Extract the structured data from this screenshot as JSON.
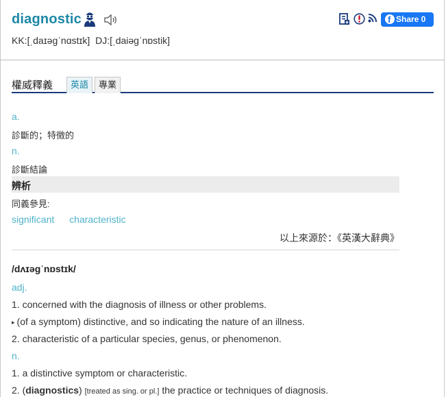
{
  "header": {
    "headword": "diagnostic",
    "kk_label": "KK:[ˌdaɪəgˈnɑstɪk]",
    "dj_label": "DJ:[ˌdaiəgˈnɒstik]",
    "share_label": "Share 0"
  },
  "tabs_section": {
    "title": "權威釋義",
    "tabs": [
      {
        "label": "英語",
        "active": true
      },
      {
        "label": "專業",
        "active": false
      }
    ]
  },
  "authoritative": {
    "entries": [
      {
        "pos": "a.",
        "meaning": "診斷的；特徵的"
      },
      {
        "pos": "n.",
        "meaning": "診斷結論"
      }
    ],
    "analysis_label": "辨析",
    "synonyms_label": "同義參見:",
    "synonyms": [
      "significant",
      "characteristic"
    ],
    "source": "以上來源於：《英漢大辭典》"
  },
  "english": {
    "phonetic": "/dʌɪəgˈnɒstɪk/",
    "adj_label": "adj.",
    "adj_defs": [
      "1. concerned with the diagnosis of illness or other problems.",
      "(of a symptom) distinctive, and so indicating the nature of an illness.",
      "2. characteristic of a particular species, genus, or phenomenon."
    ],
    "n_label": "n.",
    "n_def1": "1. a distinctive symptom or characteristic.",
    "n_def2_prefix": "2. (",
    "n_def2_word": "diagnostics",
    "n_def2_close": ")",
    "n_def2_note": "[treated as sing. or pl.]",
    "n_def2_rest": "the practice or techniques of diagnosis."
  },
  "colors": {
    "headword": "#1b87a6",
    "pos": "#4fb2c9",
    "share_button": "#1877f2",
    "tab_underline": "#1a3a7c"
  }
}
